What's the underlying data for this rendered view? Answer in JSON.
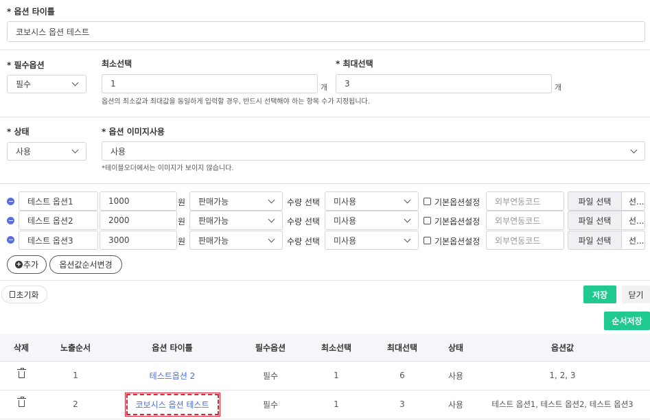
{
  "option_title": {
    "label": "* 옵션 타이틀",
    "value": "코보시스  옵션 테스트"
  },
  "required": {
    "label": "* 필수옵션",
    "value": "필수"
  },
  "min_select": {
    "label": "최소선택",
    "value": "1",
    "unit": "개"
  },
  "max_select": {
    "label": "* 최대선택",
    "value": "3",
    "unit": "개"
  },
  "select_hint": "옵션의 최소값과 최대값을 동일하게 입력할 경우, 반드시 선택해야 하는 항목 수가 지정됩니다.",
  "status": {
    "label": "* 상태",
    "value": "사용"
  },
  "image_use": {
    "label": "* 옵션 이미지사용",
    "value": "사용",
    "hint": "*테이블오더에서는 이미지가 보이지 않습니다."
  },
  "option_rows": [
    {
      "name": "테스트 옵션1",
      "price": "1000",
      "currency": "원",
      "sale": "판매가능",
      "qty_label": "수량 선택",
      "qty": "미사용",
      "default_label": "기본옵션설정",
      "ext_placeholder": "외부연동코드",
      "file_btn": "파일 선택",
      "file_ext": "선..."
    },
    {
      "name": "테스트 옵션2",
      "price": "2000",
      "currency": "원",
      "sale": "판매가능",
      "qty_label": "수량 선택",
      "qty": "미사용",
      "default_label": "기본옵션설정",
      "ext_placeholder": "외부연동코드",
      "file_btn": "파일 선택",
      "file_ext": "선..."
    },
    {
      "name": "테스트 옵션3",
      "price": "3000",
      "currency": "원",
      "sale": "판매가능",
      "qty_label": "수량 선택",
      "qty": "미사용",
      "default_label": "기본옵션설정",
      "ext_placeholder": "외부연동코드",
      "file_btn": "파일 선택",
      "file_ext": "선..."
    }
  ],
  "buttons": {
    "add": "추가",
    "reorder": "옵션값순서변경",
    "reset": "초기화",
    "save": "저장",
    "close": "닫기",
    "order_save": "순서저장"
  },
  "table": {
    "headers": [
      "삭제",
      "노출순서",
      "옵션 타이틀",
      "필수옵션",
      "최소선택",
      "최대선택",
      "상태",
      "옵션값"
    ],
    "rows": [
      {
        "order": "1",
        "title": "테스트옵션 2",
        "required": "필수",
        "min": "1",
        "max": "6",
        "status": "사용",
        "values": "1, 2, 3"
      },
      {
        "order": "2",
        "title": "코보시스 옵션 테스트",
        "required": "필수",
        "min": "1",
        "max": "3",
        "status": "사용",
        "values": "테스트 옵션1, 테스트 옵션2, 테스트 옵션3"
      }
    ]
  },
  "colors": {
    "accent_green": "#1fc990",
    "link_blue": "#4a6fd6",
    "minus_blue": "#5b6ee1",
    "highlight_red": "#d22233"
  }
}
